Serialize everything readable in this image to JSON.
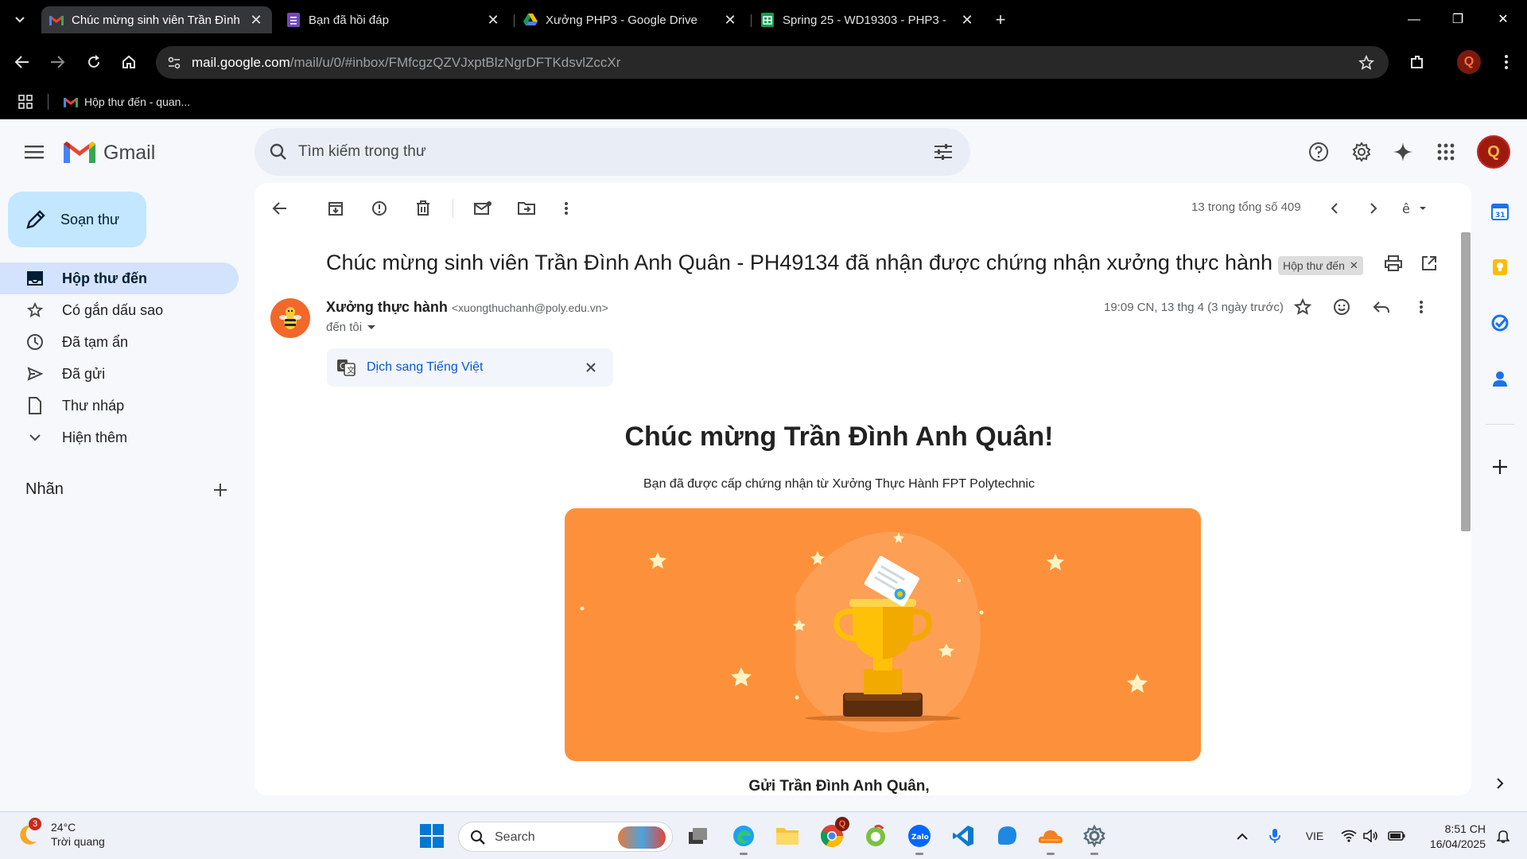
{
  "browser": {
    "tabs": [
      {
        "title": "Chúc mừng sinh viên Trần Đình",
        "icon": "gmail-icon",
        "active": true
      },
      {
        "title": "Bạn đã hồi đáp",
        "icon": "forms-icon",
        "active": false
      },
      {
        "title": "Xưởng PHP3 - Google Drive",
        "icon": "drive-icon",
        "active": false
      },
      {
        "title": "Spring 25 - WD19303 - PHP3 -",
        "icon": "sheets-icon",
        "active": false
      }
    ],
    "url_host": "mail.google.com",
    "url_path": "/mail/u/0/#inbox/FMfcgzQZVJxptBlzNgrDFTKdsvlZccXr",
    "profile_initial": "Q",
    "bookmark": "Hộp thư đến - quan..."
  },
  "gmail": {
    "brand": "Gmail",
    "search_placeholder": "Tìm kiếm trong thư",
    "avatar_initial": "Q",
    "compose_label": "Soạn thư",
    "nav": [
      {
        "label": "Hộp thư đến",
        "icon": "inbox-icon"
      },
      {
        "label": "Có gắn dấu sao",
        "icon": "star-icon"
      },
      {
        "label": "Đã tạm ẩn",
        "icon": "clock-icon"
      },
      {
        "label": "Đã gửi",
        "icon": "send-icon"
      },
      {
        "label": "Thư nháp",
        "icon": "draft-icon"
      },
      {
        "label": "Hiện thêm",
        "icon": "chevron-down-icon"
      }
    ],
    "labels_header": "Nhãn"
  },
  "message": {
    "pager": "13 trong tổng số 409",
    "subject": "Chúc mừng sinh viên Trần Đình Anh Quân - PH49134 đã nhận được chứng nhận xưởng thực hành",
    "label_chip": "Hộp thư đến",
    "sender_name": "Xưởng thực hành",
    "sender_email": "<xuongthuchanh@poly.edu.vn>",
    "to": "đến tôi",
    "time": "19:09 CN, 13 thg 4 (3 ngày trước)",
    "translate": "Dịch sang Tiếng Việt",
    "heading": "Chúc mừng Trần Đình Anh Quân!",
    "subtext": "Bạn đã được cấp chứng nhận từ Xưởng Thực Hành FPT Polytechnic",
    "greeting": "Gửi Trần Đình Anh Quân,"
  },
  "taskbar": {
    "weather_badge": "3",
    "temperature": "24°C",
    "weather_text": "Trời quang",
    "search_label": "Search",
    "language": "VIE",
    "time": "8:51 CH",
    "date": "16/04/2025",
    "chrome_badge": "Q"
  },
  "colors": {
    "banner": "#fd913b",
    "compose_bg": "#c2e7ff",
    "nav_active_bg": "#d3e3fd",
    "accent_blue": "#0b57d0"
  }
}
